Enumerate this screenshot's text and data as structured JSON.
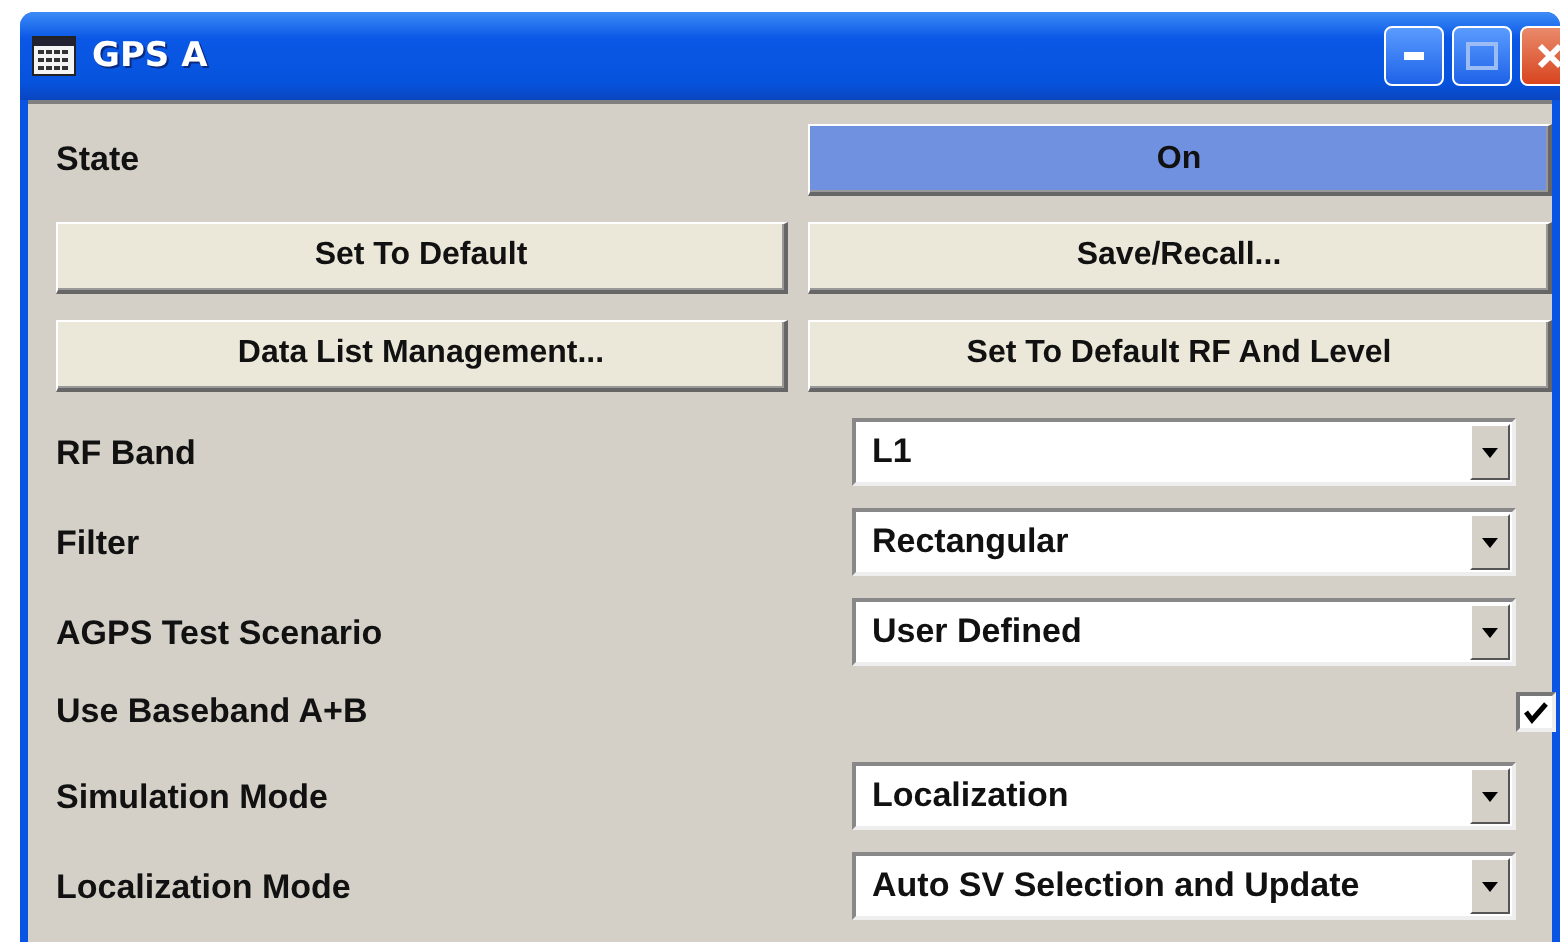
{
  "window": {
    "title": "GPS A"
  },
  "state": {
    "label": "State",
    "value": "On",
    "on": true
  },
  "buttons": [
    {
      "label": "Set To Default"
    },
    {
      "label": "Save/Recall..."
    },
    {
      "label": "Data List Management..."
    },
    {
      "label": "Set To Default RF And Level"
    }
  ],
  "settings": [
    {
      "kind": "select",
      "label": "RF Band",
      "value": "L1"
    },
    {
      "kind": "select",
      "label": "Filter",
      "value": "Rectangular"
    },
    {
      "kind": "select",
      "label": "AGPS Test Scenario",
      "value": "User Defined"
    },
    {
      "kind": "checkbox",
      "label": "Use Baseband A+B",
      "checked": true
    },
    {
      "kind": "select",
      "label": "Simulation Mode",
      "value": "Localization"
    },
    {
      "kind": "select",
      "label": "Localization Mode",
      "value": "Auto SV Selection and Update"
    }
  ]
}
